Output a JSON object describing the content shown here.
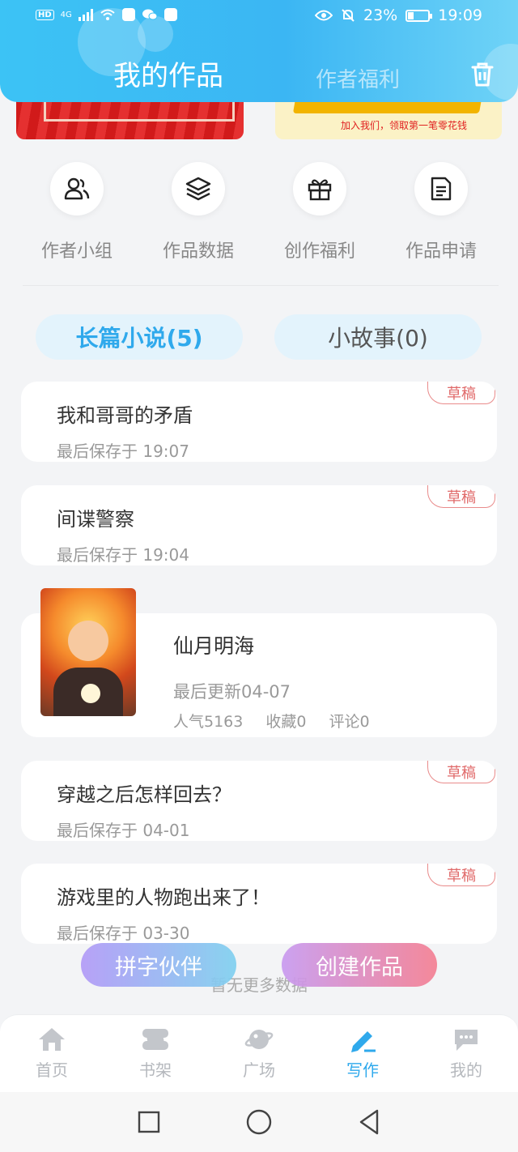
{
  "status_bar": {
    "hd": "HD",
    "network": "4G",
    "battery": "23%",
    "time": "19:09"
  },
  "header": {
    "active_tab": "我的作品",
    "tab": "作者福利"
  },
  "actions": [
    {
      "label": "作者小组",
      "icon": "people-icon"
    },
    {
      "label": "作品数据",
      "icon": "layers-icon"
    },
    {
      "label": "创作福利",
      "icon": "gift-icon"
    },
    {
      "label": "作品申请",
      "icon": "document-icon"
    }
  ],
  "segments": {
    "long": "长篇小说(5)",
    "short": "小故事(0)"
  },
  "works": [
    {
      "title": "我和哥哥的矛盾",
      "meta": "最后保存于 19:07",
      "badge": "草稿"
    },
    {
      "title": "间谍警察",
      "meta": "最后保存于 19:04",
      "badge": "草稿"
    },
    {
      "title": "穿越之后怎样回去？",
      "meta": "最后保存于 04-01",
      "badge": "草稿"
    },
    {
      "title": "游戏里的人物跑出来了！",
      "meta": "最后保存于 03-30",
      "badge": "草稿"
    }
  ],
  "published": {
    "title": "仙月明海",
    "updated": "最后更新04-07",
    "popularity": "人气5163",
    "favorites": "收藏0",
    "comments": "评论0"
  },
  "load_more": "暂无更多数据",
  "fabs": {
    "partner": "拼字伙伴",
    "create": "创建作品"
  },
  "tabbar": [
    {
      "label": "首页",
      "icon": "home-icon",
      "active": false
    },
    {
      "label": "书架",
      "icon": "bookshelf-icon",
      "active": false
    },
    {
      "label": "广场",
      "icon": "planet-icon",
      "active": false
    },
    {
      "label": "写作",
      "icon": "pen-icon",
      "active": true
    },
    {
      "label": "我的",
      "icon": "chat-bubble-icon",
      "active": false
    }
  ],
  "colors": {
    "accent": "#2fa9ec",
    "header": "#3cc3f5",
    "draft": "#e06a6a"
  }
}
